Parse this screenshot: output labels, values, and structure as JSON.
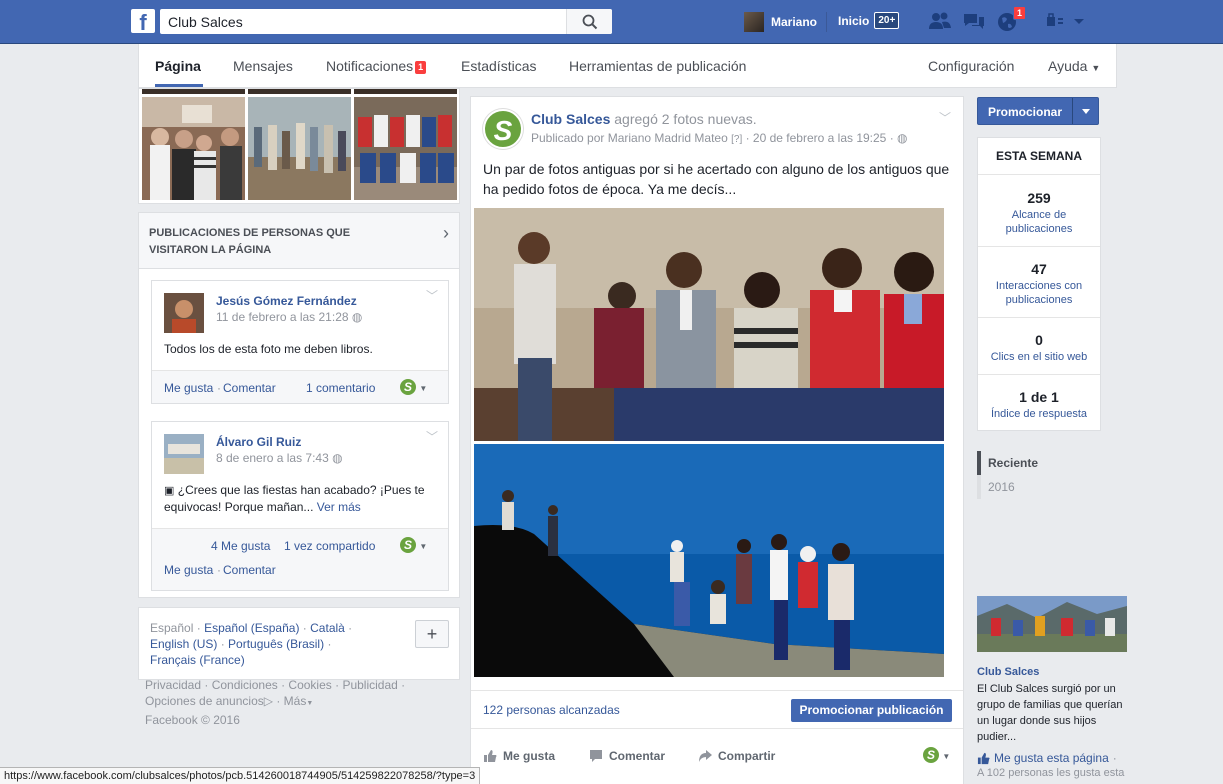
{
  "topbar": {
    "search_value": "Club Salces",
    "user_name": "Mariano",
    "home_label": "Inicio",
    "home_badge": "20+",
    "notif_badge": "1"
  },
  "pagenav": {
    "tabs": [
      {
        "label": "Página"
      },
      {
        "label": "Mensajes"
      },
      {
        "label": "Notificaciones"
      },
      {
        "label": "Estadísticas"
      },
      {
        "label": "Herramientas de publicación"
      }
    ],
    "notif_count": "1",
    "config_label": "Configuración",
    "help_label": "Ayuda"
  },
  "visitors": {
    "title": "PUBLICACIONES DE PERSONAS QUE VISITARON LA PÁGINA",
    "posts": [
      {
        "name": "Jesús Gómez Fernández",
        "date": "11 de febrero a las 21:28",
        "text": "Todos los de esta foto me deben libros.",
        "like": "Me gusta",
        "comment": "Comentar",
        "comments_count": "1 comentario"
      },
      {
        "name": "Álvaro Gil Ruiz",
        "date": "8 de enero a las 7:43",
        "text": "¿Crees que las fiestas han acabado? ¡Pues te equivocas! Porque mañan...",
        "see_more": "Ver más",
        "likes_count": "4 Me gusta",
        "shares_count": "1 vez compartido",
        "like": "Me gusta",
        "comment": "Comentar"
      }
    ]
  },
  "languages": {
    "lang1": "Español",
    "lang2": "Español (España)",
    "lang3": "Català",
    "lang4": "English (US)",
    "lang5": "Português (Brasil)",
    "lang6": "Français (France)"
  },
  "footer": {
    "privacy": "Privacidad",
    "terms": "Condiciones",
    "cookies": "Cookies",
    "ads": "Publicidad",
    "ad_options": "Opciones de anuncios",
    "more": "Más",
    "copyright": "Facebook © 2016"
  },
  "post": {
    "page_name": "Club Salces",
    "action": "agregó 2 fotos nuevas.",
    "published_by": "Publicado por Mariano Madrid Mateo",
    "bracket": "[?]",
    "date": "20 de febrero a las 19:25",
    "text": "Un par de fotos antiguas por si he acertado con alguno de los antiguos que ha pedido fotos de época. Ya me decís...",
    "reach": "122 personas alcanzadas",
    "promote_post": "Promocionar publicación",
    "like": "Me gusta",
    "comment": "Comentar",
    "share": "Compartir"
  },
  "right": {
    "promote": "Promocionar",
    "week_title": "ESTA SEMANA",
    "stats": [
      {
        "num": "259",
        "label": "Alcance de publicaciones"
      },
      {
        "num": "47",
        "label": "Interacciones con publicaciones"
      },
      {
        "num": "0",
        "label": "Clics en el sitio web"
      },
      {
        "num": "1 de 1",
        "label": "Índice de respuesta"
      }
    ],
    "timeline": [
      "Reciente",
      "2016"
    ],
    "ad_title": "Club Salces",
    "ad_text": "El Club Salces surgió por un grupo de familias que querían un lugar donde sus hijos pudier...",
    "ad_like": "Me gusta esta página",
    "ad_count": "A 102 personas les gusta esta"
  },
  "statusbar": {
    "url": "https://www.facebook.com/clubsalces/photos/pcb.514260018744905/514259822078258/?type=3"
  },
  "colors": {
    "brand_blue": "#4267b2",
    "club_green": "#6aa33f",
    "badge_red": "#fa3e3e"
  }
}
